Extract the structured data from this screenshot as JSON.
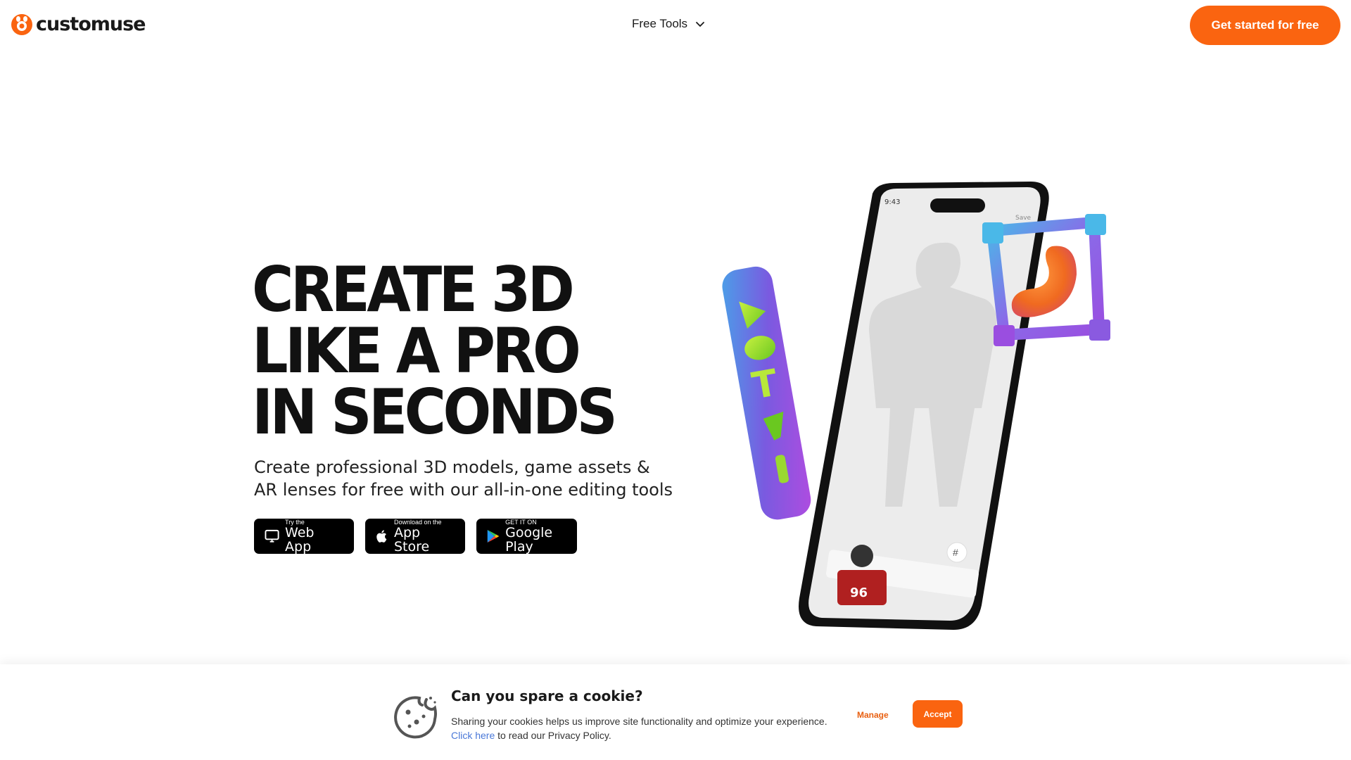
{
  "brand": {
    "name": "customuse",
    "accent": "#fa6410"
  },
  "nav": {
    "free_tools_label": "Free Tools",
    "cta_label": "Get started for free"
  },
  "hero": {
    "title_lines": [
      "CREATE 3D",
      "LIKE A PRO",
      "IN SECONDS"
    ],
    "subtitle": "Create professional 3D models, game assets & AR lenses for free with our all-in-one editing tools"
  },
  "stores": {
    "web": {
      "small": "Try the",
      "big": "Web App",
      "icon": "monitor-icon"
    },
    "apple": {
      "small": "Download on the",
      "big": "App Store",
      "icon": "apple-icon"
    },
    "google": {
      "small": "GET IT ON",
      "big": "Google Play",
      "icon": "google-play-icon"
    }
  },
  "phone": {
    "time": "9:43",
    "save_label": "Save",
    "jersey_number": "96"
  },
  "cookie": {
    "title": "Can you spare a cookie?",
    "text": "Sharing your cookies helps us improve site functionality and optimize your experience.",
    "link_label": "Click here",
    "link_suffix": " to read our Privacy Policy.",
    "manage_label": "Manage",
    "accept_label": "Accept"
  }
}
